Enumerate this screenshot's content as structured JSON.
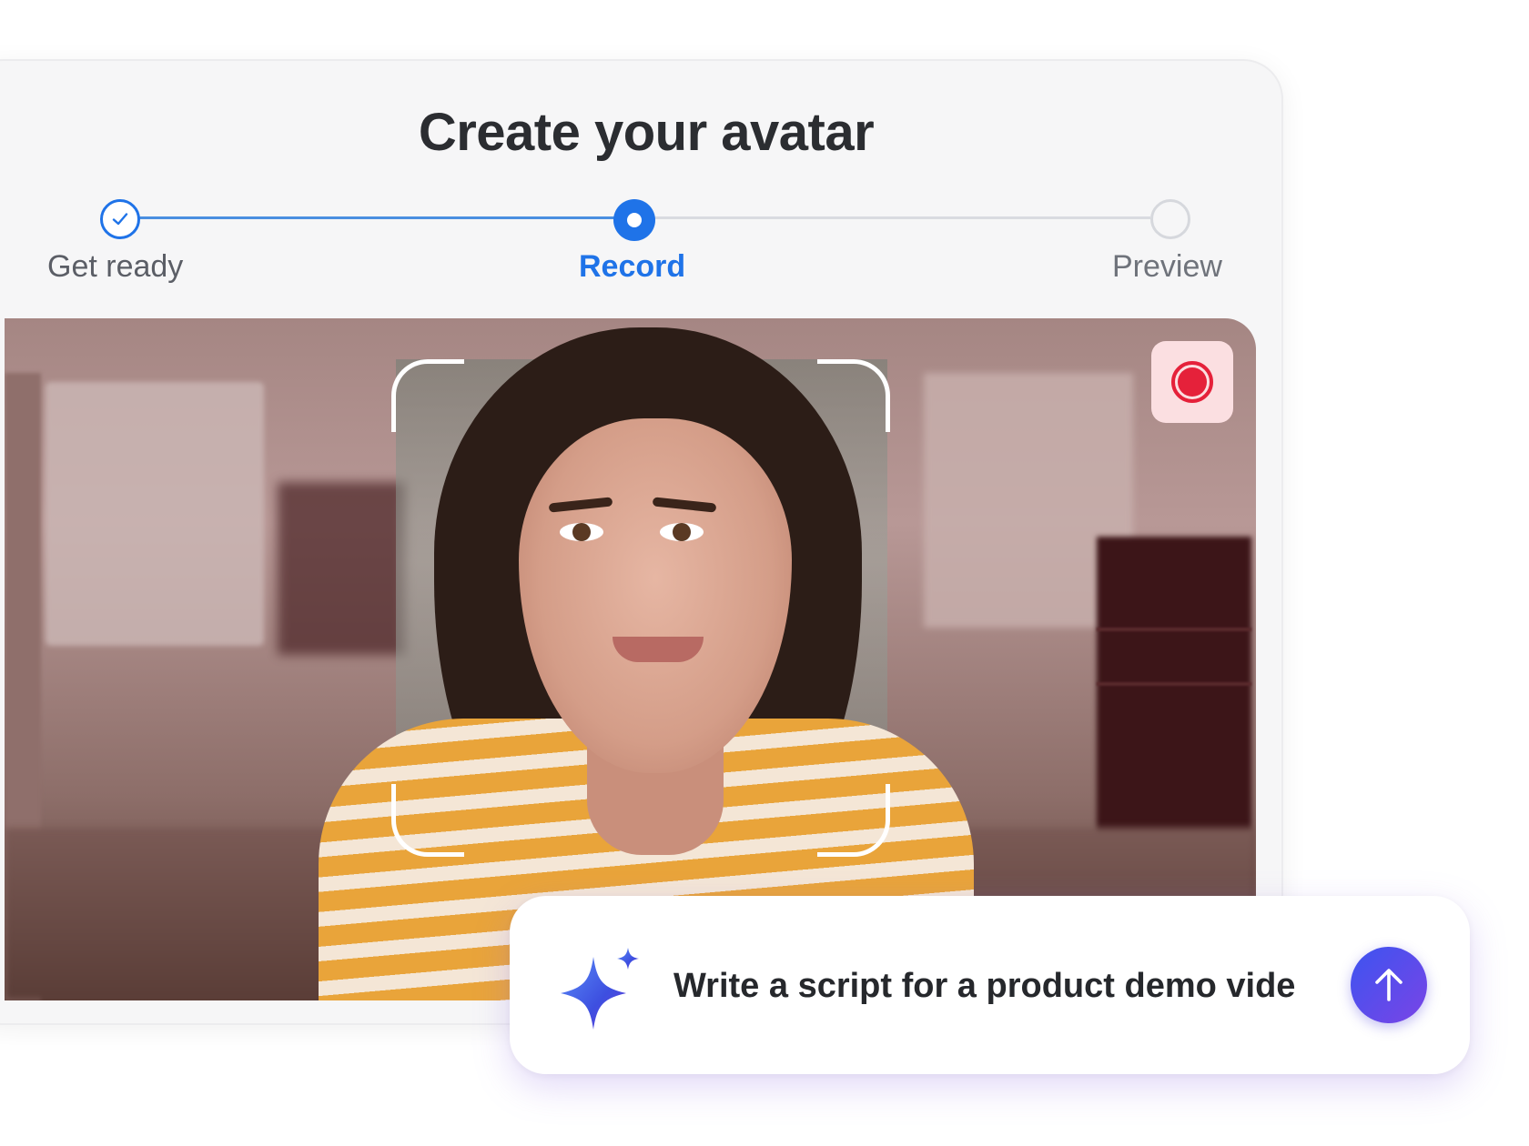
{
  "title": "Create your avatar",
  "stepper": {
    "steps": [
      {
        "label": "Get ready",
        "state": "completed"
      },
      {
        "label": "Record",
        "state": "active"
      },
      {
        "label": "Preview",
        "state": "upcoming"
      }
    ]
  },
  "recorder": {
    "record_button_icon": "record-icon",
    "frame_icon": "face-scan-frame"
  },
  "prompt": {
    "text": "Write a script for a product demo vide",
    "leading_icon": "sparkle-icon",
    "send_icon": "arrow-up-icon"
  },
  "colors": {
    "accent": "#1f73e8",
    "record": "#e5213a",
    "send_gradient": [
      "#3c54f0",
      "#7a44e6"
    ]
  }
}
